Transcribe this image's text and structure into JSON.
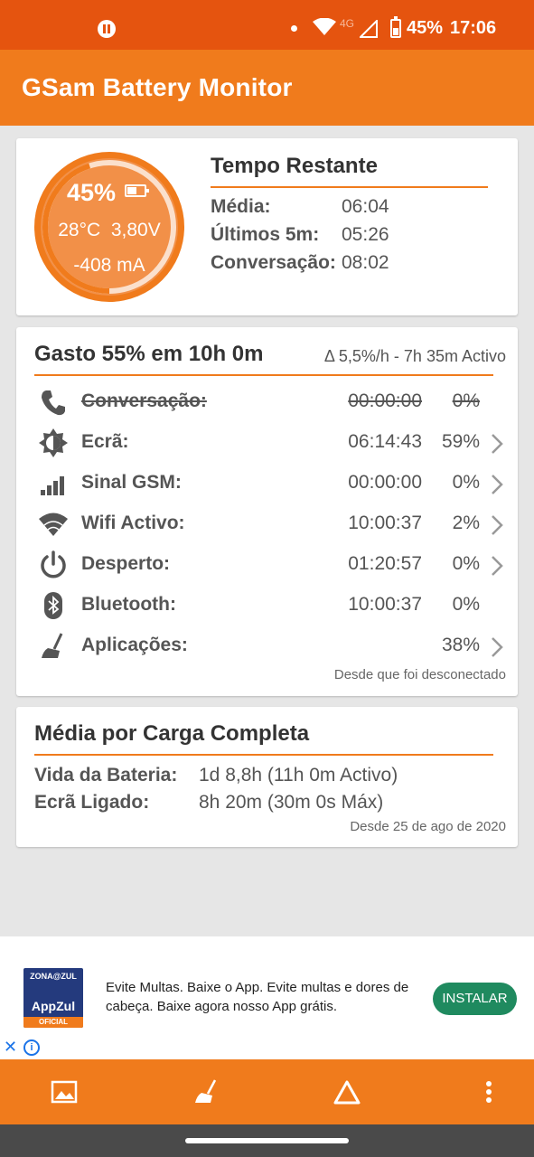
{
  "status_bar": {
    "battery_pct": "45%",
    "time": "17:06",
    "network": "4G"
  },
  "app_bar": {
    "title": "GSam Battery Monitor"
  },
  "summary": {
    "gauge": {
      "percent": "45%",
      "fill_fraction": 0.45,
      "temp": "28°C",
      "voltage": "3,80V",
      "current": "-408 mA"
    },
    "tempo_restante": {
      "title": "Tempo Restante",
      "rows": [
        {
          "label": "Média:",
          "value": "06:04"
        },
        {
          "label": "Últimos 5m:",
          "value": "05:26"
        },
        {
          "label": "Conversação:",
          "value": "08:02"
        }
      ]
    }
  },
  "usage": {
    "title": "Gasto 55% em 10h 0m",
    "rate": "Δ 5,5%/h - 7h 35m Activo",
    "rows": [
      {
        "icon": "phone-icon",
        "label": "Conversação:",
        "time": "00:00:00",
        "pct": "0%",
        "strikethrough": true,
        "chevron": false
      },
      {
        "icon": "brightness-icon",
        "label": "Ecrã:",
        "time": "06:14:43",
        "pct": "59%",
        "strikethrough": false,
        "chevron": true
      },
      {
        "icon": "signal-icon",
        "label": "Sinal GSM:",
        "time": "00:00:00",
        "pct": "0%",
        "strikethrough": false,
        "chevron": true
      },
      {
        "icon": "wifi-icon",
        "label": "Wifi Activo:",
        "time": "10:00:37",
        "pct": "2%",
        "strikethrough": false,
        "chevron": true
      },
      {
        "icon": "power-icon",
        "label": "Desperto:",
        "time": "01:20:57",
        "pct": "0%",
        "strikethrough": false,
        "chevron": true
      },
      {
        "icon": "bluetooth-icon",
        "label": "Bluetooth:",
        "time": "10:00:37",
        "pct": "0%",
        "strikethrough": false,
        "chevron": false
      },
      {
        "icon": "broom-icon",
        "label": "Aplicações:",
        "time": "",
        "pct": "38%",
        "strikethrough": false,
        "chevron": true
      }
    ],
    "since": "Desde que foi desconectado"
  },
  "average": {
    "title": "Média por Carga Completa",
    "rows": [
      {
        "label": "Vida da Bateria:",
        "value": "1d 8,8h (11h 0m Activo)"
      },
      {
        "label": "Ecrã Ligado:",
        "value": "8h 20m (30m 0s Máx)"
      }
    ],
    "since": "Desde 25 de ago de 2020"
  },
  "ad": {
    "logo_top": "ZONA@ZUL",
    "logo_mid": "AppZul",
    "logo_bottom": "OFICIAL",
    "text": "Evite Multas. Baixe o App. Evite multas e dores de cabeça. Baixe agora nosso App grátis.",
    "button": "INSTALAR",
    "close": "✕",
    "info": "i"
  },
  "bottom_bar": {
    "icons": [
      "image-icon",
      "broom-icon",
      "triangle-icon",
      "more-vert-icon"
    ]
  },
  "colors": {
    "status_bar": "#e5540f",
    "app_bar": "#f07b1c",
    "accent": "#f07b1c",
    "install_button": "#1f8a5f"
  }
}
